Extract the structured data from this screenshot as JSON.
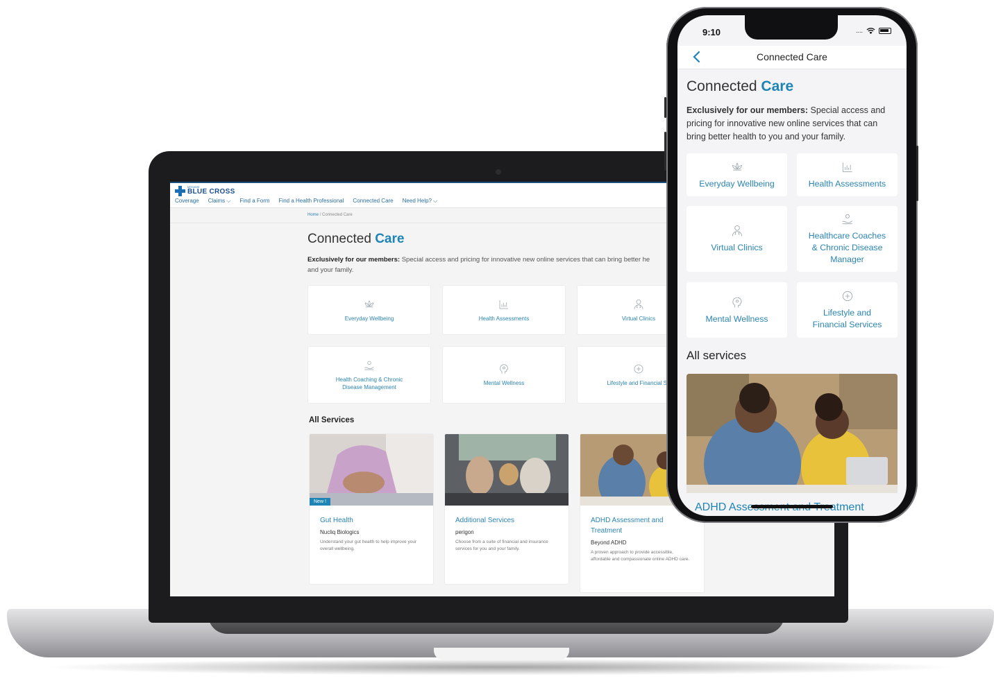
{
  "laptop": {
    "logo": {
      "small": "MEDAVIE",
      "main": "BLUE CROSS"
    },
    "nav": [
      "Coverage",
      "Claims ⌵",
      "Find a Form",
      "Find a Health Professional",
      "Connected Care",
      "Need Help? ⌵"
    ],
    "breadcrumb": {
      "home": "Home",
      "sep": "/",
      "current": "Connected Care"
    },
    "title": {
      "part1": "Connected ",
      "part2": "Care"
    },
    "intro": {
      "bold": "Exclusively for our members:",
      "text": " Special access and pricing for innovative new online services that can bring better he",
      "text2": "and your family."
    },
    "categories": [
      {
        "label": "Everyday Wellbeing",
        "icon": "lotus-icon"
      },
      {
        "label": "Health Assessments",
        "icon": "bar-chart-icon"
      },
      {
        "label": "Virtual Clinics",
        "icon": "doctor-icon"
      },
      {
        "label": "Health Coaching & Chronic",
        "label2": "Disease Management",
        "icon": "hand-care-icon"
      },
      {
        "label": "Mental Wellness",
        "icon": "head-icon"
      },
      {
        "label": "Lifestyle and Financial Se",
        "icon": "plus-circle-icon"
      }
    ],
    "all_services_title": "All Services",
    "services": [
      {
        "name": "Gut Health",
        "provider": "Nucliq Biologics",
        "desc": "Understand your gut health to help improve your overall wellbeing.",
        "badge": "New !"
      },
      {
        "name": "Additional Services",
        "provider": "perigon",
        "desc": "Choose from a suite of financial and insurance services for you and your family."
      },
      {
        "name": "ADHD Assessment and Treatment",
        "provider": "Beyond ADHD",
        "desc": "A proven approach to provide accessible, affordable and compassionate online ADHD care."
      }
    ]
  },
  "phone": {
    "time": "9:10",
    "signal": "....",
    "app_title": "Connected Care",
    "title": {
      "part1": "Connected ",
      "part2": "Care"
    },
    "intro": {
      "bold": "Exclusively for our members:",
      "text": " Special access and pricing for innovative new online services that can bring better health to you and your family."
    },
    "categories": [
      {
        "label": "Everyday Wellbeing",
        "icon": "lotus-icon"
      },
      {
        "label": "Health Assessments",
        "icon": "bar-chart-icon"
      },
      {
        "label": "Virtual Clinics",
        "icon": "doctor-icon"
      },
      {
        "label": "Healthcare Coaches & Chronic Disease Manager",
        "icon": "hand-care-icon"
      },
      {
        "label": "Mental Wellness",
        "icon": "head-icon"
      },
      {
        "label": "Lifestyle and Financial Services",
        "icon": "plus-circle-icon"
      }
    ],
    "all_services_title": "All services",
    "first_service": "ADHD Assessment and Treatment"
  },
  "colors": {
    "accent": "#1d84b5",
    "brand_blue": "#1b4f8d",
    "page_bg": "#f4f4f5"
  }
}
